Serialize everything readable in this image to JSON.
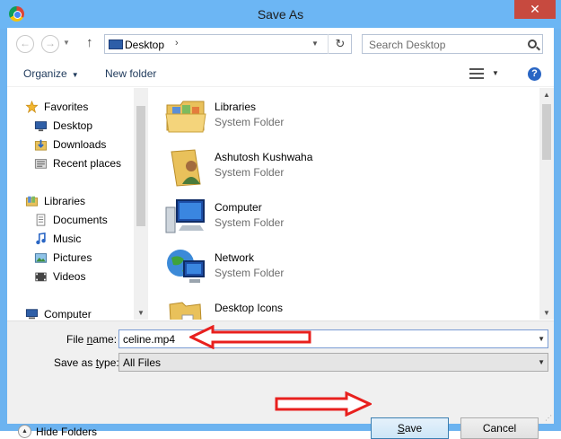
{
  "window": {
    "title": "Save As",
    "close_glyph": "✕"
  },
  "nav": {
    "back_glyph": "←",
    "forward_glyph": "→",
    "up_glyph": "↑",
    "history_dd_glyph": "▼",
    "address": {
      "location": "Desktop",
      "separator_glyph": "›",
      "dropdown_glyph": "▼",
      "refresh_glyph": "↻"
    },
    "search": {
      "placeholder": "Search Desktop"
    }
  },
  "toolbar": {
    "organize": "Organize",
    "organize_caret": "▼",
    "new_folder": "New folder",
    "view_dd_glyph": "▼",
    "help_glyph": "?"
  },
  "sidebar": {
    "favorites": {
      "label": "Favorites",
      "items": [
        {
          "label": "Desktop",
          "icon": "desktop-icon"
        },
        {
          "label": "Downloads",
          "icon": "downloads-icon"
        },
        {
          "label": "Recent places",
          "icon": "recent-places-icon"
        }
      ]
    },
    "libraries": {
      "label": "Libraries",
      "items": [
        {
          "label": "Documents",
          "icon": "documents-icon"
        },
        {
          "label": "Music",
          "icon": "music-icon"
        },
        {
          "label": "Pictures",
          "icon": "pictures-icon"
        },
        {
          "label": "Videos",
          "icon": "videos-icon"
        }
      ]
    },
    "computer": {
      "label": "Computer"
    }
  },
  "files": [
    {
      "name": "Libraries",
      "type": "System Folder",
      "icon": "libraries-folder-icon"
    },
    {
      "name": "Ashutosh Kushwaha",
      "type": "System Folder",
      "icon": "user-folder-icon"
    },
    {
      "name": "Computer",
      "type": "System Folder",
      "icon": "computer-icon"
    },
    {
      "name": "Network",
      "type": "System Folder",
      "icon": "network-icon"
    },
    {
      "name": "Desktop Icons",
      "type": "",
      "icon": "folder-icon"
    }
  ],
  "form": {
    "file_name_label_pre": "File ",
    "file_name_label_key": "n",
    "file_name_label_post": "ame:",
    "file_name_value": "celine.mp4",
    "save_as_type_label_pre": "Save as ",
    "save_as_type_label_key": "t",
    "save_as_type_label_post": "ype:",
    "save_as_type_value": "All Files",
    "dropdown_glyph": "▼"
  },
  "footer": {
    "hide_folders": "Hide Folders",
    "hide_glyph": "▲",
    "save_key": "S",
    "save_rest": "ave",
    "cancel": "Cancel"
  },
  "scroll": {
    "up_glyph": "▲",
    "down_glyph": "▼"
  },
  "colors": {
    "accent": "#6cb6f4",
    "close": "#c74a3f",
    "annotation": "#e8201e"
  }
}
